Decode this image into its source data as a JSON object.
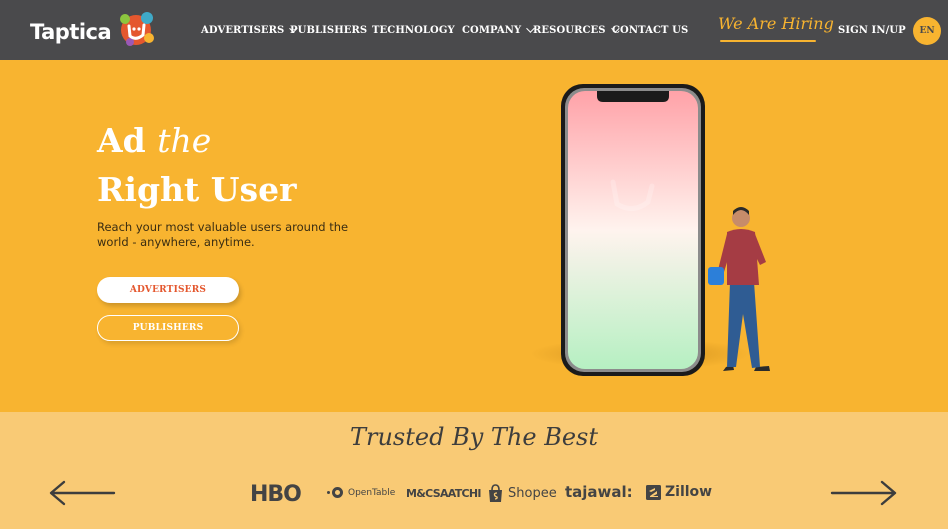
{
  "header": {
    "logo_text": "Taptica",
    "nav": [
      {
        "label": "ADVERTISERS",
        "dropdown": true
      },
      {
        "label": "PUBLISHERS",
        "dropdown": false
      },
      {
        "label": "TECHNOLOGY",
        "dropdown": false
      },
      {
        "label": "COMPANY",
        "dropdown": true
      },
      {
        "label": "RESOURCES",
        "dropdown": true
      },
      {
        "label": "CONTACT US",
        "dropdown": false
      }
    ],
    "hiring_label": "We Are Hiring",
    "signin_label": "SIGN IN/UP",
    "lang_label": "EN"
  },
  "hero": {
    "title_line1_bold": "Ad",
    "title_line1_italic": "the",
    "title_line2": "Right User",
    "subtitle": "Reach your most valuable users around the world - anywhere, anytime.",
    "advertisers_button": "ADVERTISERS",
    "publishers_button": "PUBLISHERS"
  },
  "trusted": {
    "title": "Trusted By The Best",
    "brands": [
      "HBO",
      "OpenTable",
      "M&CSAATCHI",
      "Shopee",
      "tajawal:",
      "Zillow"
    ]
  },
  "colors": {
    "header_bg": "#4a4a4c",
    "accent_yellow": "#f8b430",
    "band_bg": "#f9ca75",
    "cta_red": "#e4572e"
  }
}
